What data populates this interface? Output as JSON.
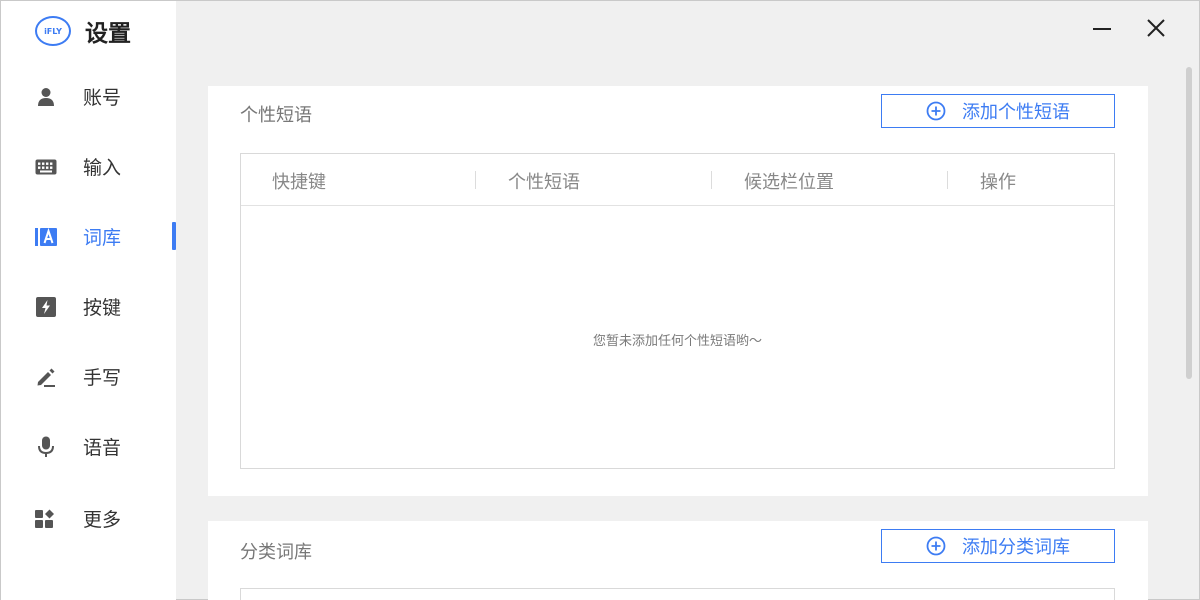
{
  "app": {
    "title": "设置",
    "logo_text": "iFLY"
  },
  "sidebar": {
    "items": [
      {
        "label": "账号",
        "icon": "user-icon"
      },
      {
        "label": "输入",
        "icon": "keyboard-icon"
      },
      {
        "label": "词库",
        "icon": "dictionary-icon",
        "active": true
      },
      {
        "label": "按键",
        "icon": "lightning-icon"
      },
      {
        "label": "手写",
        "icon": "pen-icon"
      },
      {
        "label": "语音",
        "icon": "microphone-icon"
      },
      {
        "label": "更多",
        "icon": "more-grid-icon"
      }
    ]
  },
  "window_controls": {
    "minimize_icon": "minimize-icon",
    "close_icon": "close-icon"
  },
  "phrases_section": {
    "title": "个性短语",
    "add_button": "添加个性短语",
    "columns": [
      "快捷键",
      "个性短语",
      "候选栏位置",
      "操作"
    ],
    "empty_text": "您暂未添加任何个性短语哟～"
  },
  "category_section": {
    "title": "分类词库",
    "add_button": "添加分类词库"
  },
  "colors": {
    "accent": "#3d7cf3",
    "background": "#f0f0f0",
    "card": "#ffffff"
  }
}
